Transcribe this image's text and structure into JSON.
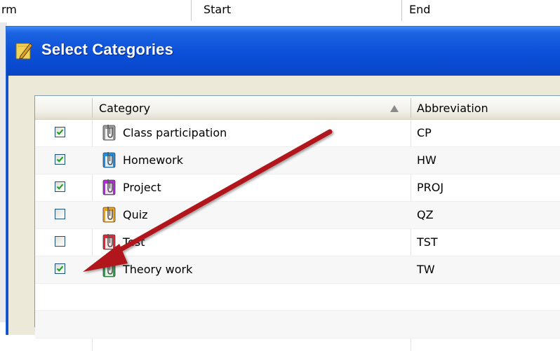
{
  "background_list": {
    "columns": [
      "rm",
      "Start",
      "End"
    ]
  },
  "dialog": {
    "title": "Select Categories",
    "grid": {
      "headers": {
        "select": "",
        "category": "Category",
        "abbreviation": "Abbreviation"
      },
      "sort": "ascending",
      "rows": [
        {
          "checked": true,
          "category": "Class participation",
          "abbreviation": "CP",
          "icon_color": "#9a9a9a"
        },
        {
          "checked": true,
          "category": "Homework",
          "abbreviation": "HW",
          "icon_color": "#1e8fe0"
        },
        {
          "checked": true,
          "category": "Project",
          "abbreviation": "PROJ",
          "icon_color": "#b02cd6"
        },
        {
          "checked": false,
          "category": "Quiz",
          "abbreviation": "QZ",
          "icon_color": "#e9a21a"
        },
        {
          "checked": false,
          "category": "Test",
          "abbreviation": "TST",
          "icon_color": "#e0283a"
        },
        {
          "checked": true,
          "category": "Theory work",
          "abbreviation": "TW",
          "icon_color": "#2fa34a"
        }
      ]
    }
  },
  "annotation": {
    "arrow_color": "#b1191c"
  },
  "colors": {
    "titlebar": "#0b4fd8",
    "checkmark": "#21a121"
  }
}
